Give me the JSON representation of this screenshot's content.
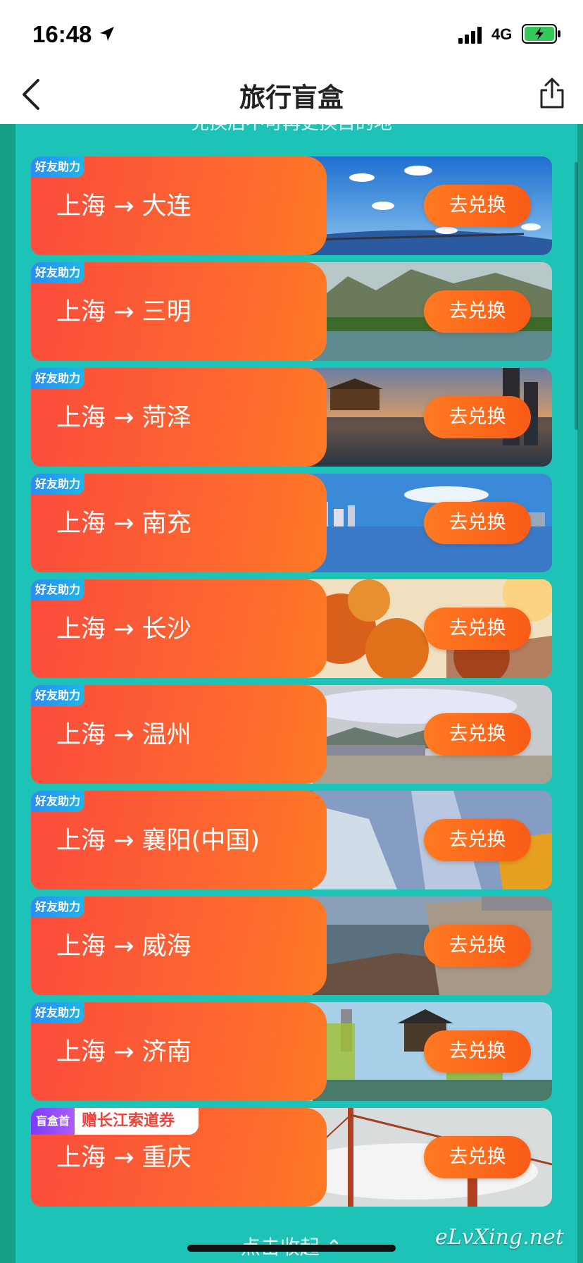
{
  "status_bar": {
    "time": "16:48",
    "network": "4G",
    "icons": [
      "location-arrow-icon",
      "signal-bars-icon",
      "battery-charging-icon"
    ],
    "battery_color": "#34c759"
  },
  "nav": {
    "title": "旅行盲盒",
    "back_icon": "chevron-left-icon",
    "share_icon": "share-icon"
  },
  "panel": {
    "hint": "兑换后不可再更换目的地"
  },
  "colors": {
    "background": "#14a089",
    "panel": "#1dc3b6",
    "card_orange": "#fd6a2e",
    "button_orange": "#ff7a22",
    "friend_tag": "#2a8df5",
    "promo_tag": "#7a3cff",
    "promo_text": "#f0413a"
  },
  "cards": [
    {
      "tag": "好友助力",
      "route": "上海 → 大连",
      "button": "去兑换"
    },
    {
      "tag": "好友助力",
      "route": "上海 → 三明",
      "button": "去兑换"
    },
    {
      "tag": "好友助力",
      "route": "上海 → 菏泽",
      "button": "去兑换"
    },
    {
      "tag": "好友助力",
      "route": "上海 → 南充",
      "button": "去兑换"
    },
    {
      "tag": "好友助力",
      "route": "上海 → 长沙",
      "button": "去兑换"
    },
    {
      "tag": "好友助力",
      "route": "上海 → 温州",
      "button": "去兑换"
    },
    {
      "tag": "好友助力",
      "route": "上海 → 襄阳(中国)",
      "button": "去兑换"
    },
    {
      "tag": "好友助力",
      "route": "上海 → 威海",
      "button": "去兑换"
    },
    {
      "tag": "好友助力",
      "route": "上海 → 济南",
      "button": "去兑换"
    },
    {
      "tag": "盲盒首开",
      "tag_extra": "赠长江索道券",
      "route": "上海 → 重庆",
      "button": "去兑换"
    }
  ],
  "footer": {
    "collapse": "点击收起 ⌃",
    "watermark": "eLvXing.net"
  }
}
